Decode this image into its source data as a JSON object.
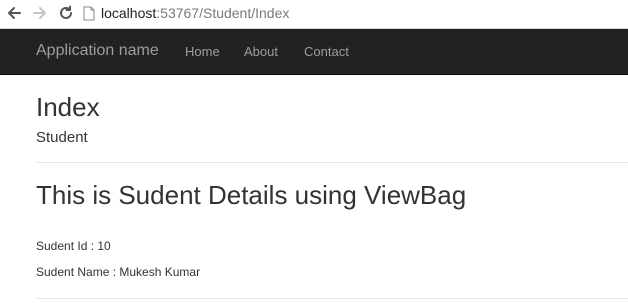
{
  "browser": {
    "url_host": "localhost",
    "url_rest": ":53767/Student/Index",
    "icons": {
      "back": "back-arrow-icon",
      "forward": "forward-arrow-icon",
      "reload": "reload-icon",
      "page": "page-icon"
    }
  },
  "navbar": {
    "brand": "Application name",
    "links": [
      "Home",
      "About",
      "Contact"
    ],
    "background": "#222222",
    "link_color": "#9d9d9d"
  },
  "main": {
    "title": "Index",
    "subtitle": "Student",
    "section_heading": "This is Sudent Details using ViewBag",
    "student_id": "Sudent Id : 10",
    "student_name": "Sudent Name : Mukesh Kumar"
  }
}
